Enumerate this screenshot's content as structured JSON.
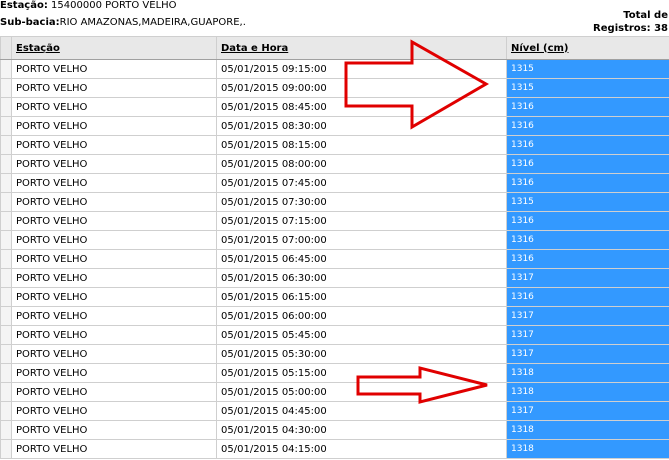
{
  "header": {
    "estacao_label": "Estação:",
    "estacao_value": "15400000 PORTO VELHO",
    "subbacia_label": "Sub-bacia:",
    "subbacia_value": "RIO AMAZONAS,MADEIRA,GUAPORE,.",
    "total_line1": "Total de",
    "total_line2": "Registros: 38"
  },
  "table": {
    "columns": [
      "Estação",
      "Data e Hora",
      "Nível (cm)"
    ],
    "rows": [
      [
        "PORTO VELHO",
        "05/01/2015 09:15:00",
        "1315"
      ],
      [
        "PORTO VELHO",
        "05/01/2015 09:00:00",
        "1315"
      ],
      [
        "PORTO VELHO",
        "05/01/2015 08:45:00",
        "1316"
      ],
      [
        "PORTO VELHO",
        "05/01/2015 08:30:00",
        "1316"
      ],
      [
        "PORTO VELHO",
        "05/01/2015 08:15:00",
        "1316"
      ],
      [
        "PORTO VELHO",
        "05/01/2015 08:00:00",
        "1316"
      ],
      [
        "PORTO VELHO",
        "05/01/2015 07:45:00",
        "1316"
      ],
      [
        "PORTO VELHO",
        "05/01/2015 07:30:00",
        "1315"
      ],
      [
        "PORTO VELHO",
        "05/01/2015 07:15:00",
        "1316"
      ],
      [
        "PORTO VELHO",
        "05/01/2015 07:00:00",
        "1316"
      ],
      [
        "PORTO VELHO",
        "05/01/2015 06:45:00",
        "1316"
      ],
      [
        "PORTO VELHO",
        "05/01/2015 06:30:00",
        "1317"
      ],
      [
        "PORTO VELHO",
        "05/01/2015 06:15:00",
        "1316"
      ],
      [
        "PORTO VELHO",
        "05/01/2015 06:00:00",
        "1317"
      ],
      [
        "PORTO VELHO",
        "05/01/2015 05:45:00",
        "1317"
      ],
      [
        "PORTO VELHO",
        "05/01/2015 05:30:00",
        "1317"
      ],
      [
        "PORTO VELHO",
        "05/01/2015 05:15:00",
        "1318"
      ],
      [
        "PORTO VELHO",
        "05/01/2015 05:00:00",
        "1318"
      ],
      [
        "PORTO VELHO",
        "05/01/2015 04:45:00",
        "1317"
      ],
      [
        "PORTO VELHO",
        "05/01/2015 04:30:00",
        "1318"
      ],
      [
        "PORTO VELHO",
        "05/01/2015 04:15:00",
        "1318"
      ]
    ]
  },
  "colors": {
    "highlight": "#3399ff",
    "arrow": "#e00000"
  }
}
